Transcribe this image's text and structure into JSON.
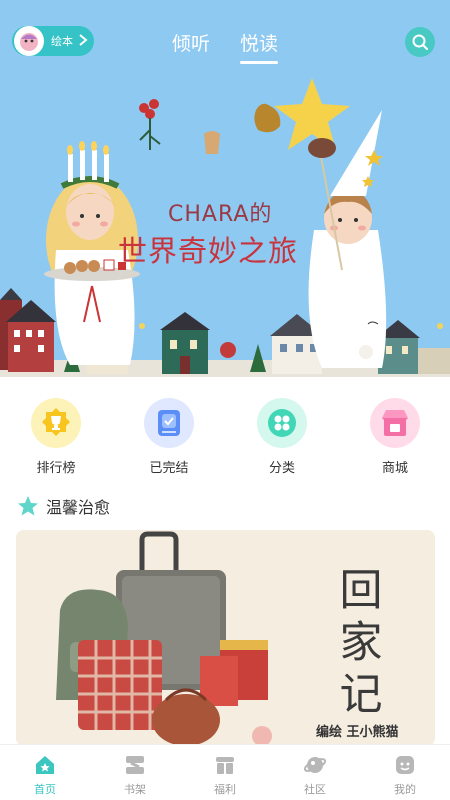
{
  "header": {
    "mode_label": "绘本",
    "tabs": [
      {
        "label": "倾听",
        "active": false
      },
      {
        "label": "悦读",
        "active": true
      }
    ],
    "search_icon": "search-icon"
  },
  "banner": {
    "title_line1": "CHARA的",
    "title_line2": "世界奇妙之旅"
  },
  "quick_entries": [
    {
      "label": "排行榜",
      "icon": "trophy-icon",
      "color": "#f9d23c"
    },
    {
      "label": "已完结",
      "icon": "finished-book-icon",
      "color": "#5b8ff7"
    },
    {
      "label": "分类",
      "icon": "category-icon",
      "color": "#41d6b6"
    },
    {
      "label": "商城",
      "icon": "store-icon",
      "color": "#f46fa6"
    }
  ],
  "section": {
    "title": "温馨治愈",
    "star_icon": "star-icon"
  },
  "book": {
    "title": "回家记",
    "author": "编绘 王小熊猫"
  },
  "bottom_nav": [
    {
      "label": "首页",
      "icon": "home-icon",
      "active": true
    },
    {
      "label": "书架",
      "icon": "bookshelf-icon",
      "active": false
    },
    {
      "label": "福利",
      "icon": "gift-icon",
      "active": false
    },
    {
      "label": "社区",
      "icon": "planet-icon",
      "active": false
    },
    {
      "label": "我的",
      "icon": "profile-icon",
      "active": false
    }
  ],
  "colors": {
    "accent": "#3cc6c0",
    "banner_sky": "#8ec9f1"
  }
}
